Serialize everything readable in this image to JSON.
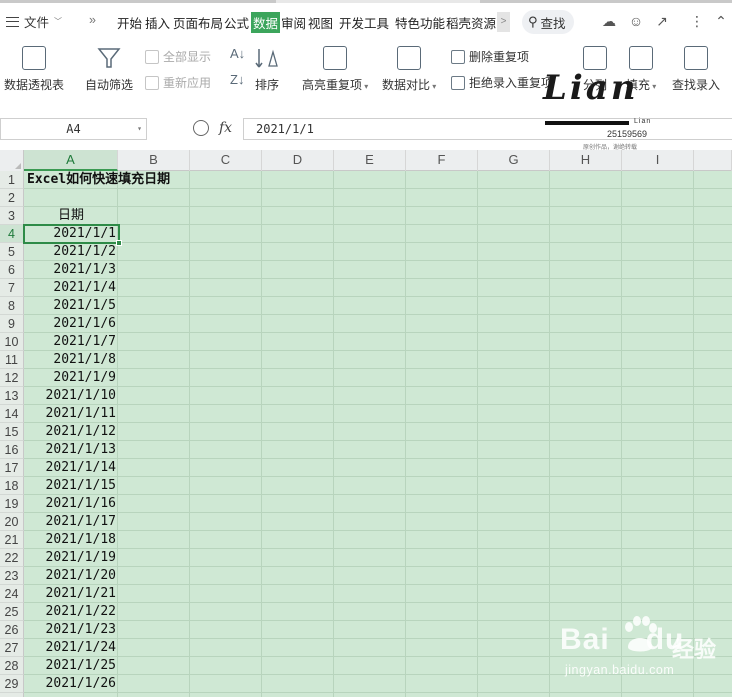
{
  "menubar": {
    "file_label": "文件",
    "tabs": [
      "开始",
      "插入",
      "页面布局",
      "公式",
      "数据",
      "审阅",
      "视图",
      "开发工具",
      "特色功能",
      "稻壳资源"
    ],
    "active_tab": "数据",
    "search_label": "查找",
    "overflow_glyph": "»",
    "scroll_glyph": ">"
  },
  "ribbon": {
    "pivot_table": "数据透视表",
    "auto_filter": "自动筛选",
    "show_all": "全部显示",
    "reapply": "重新应用",
    "sort": "排序",
    "highlight_dupes": "高亮重复项",
    "data_compare": "数据对比",
    "delete_dupes": "删除重复项",
    "reject_dupes": "拒绝录入重复项",
    "split": "分列",
    "fill": "填充",
    "find_entry": "查找录入"
  },
  "formula_bar": {
    "name_box": "A4",
    "fx_label": "fx",
    "content": "2021/1/1"
  },
  "columns": [
    "A",
    "B",
    "C",
    "D",
    "E",
    "F",
    "G",
    "H",
    "I"
  ],
  "selected_column": "A",
  "selected_row": "4",
  "sheet": {
    "title": "Excel如何快速填充日期",
    "header": "日期",
    "dates": [
      "2021/1/1",
      "2021/1/2",
      "2021/1/3",
      "2021/1/4",
      "2021/1/5",
      "2021/1/6",
      "2021/1/7",
      "2021/1/8",
      "2021/1/9",
      "2021/1/10",
      "2021/1/11",
      "2021/1/12",
      "2021/1/13",
      "2021/1/14",
      "2021/1/15",
      "2021/1/16",
      "2021/1/17",
      "2021/1/18",
      "2021/1/19",
      "2021/1/20",
      "2021/1/21",
      "2021/1/22",
      "2021/1/23",
      "2021/1/24",
      "2021/1/25",
      "2021/1/26"
    ]
  },
  "watermark": {
    "signature": "Lian",
    "small_name": "Lian",
    "number": "25159569",
    "note": "原创作品，谢绝转载",
    "baidu_logo": "Bai",
    "baidu_du": "du",
    "jingyan": "经验",
    "url": "jingyan.baidu.com"
  },
  "colors": {
    "accent": "#3ca55c",
    "grid_bg": "#cfe8d4",
    "selection": "#2e8b47"
  }
}
